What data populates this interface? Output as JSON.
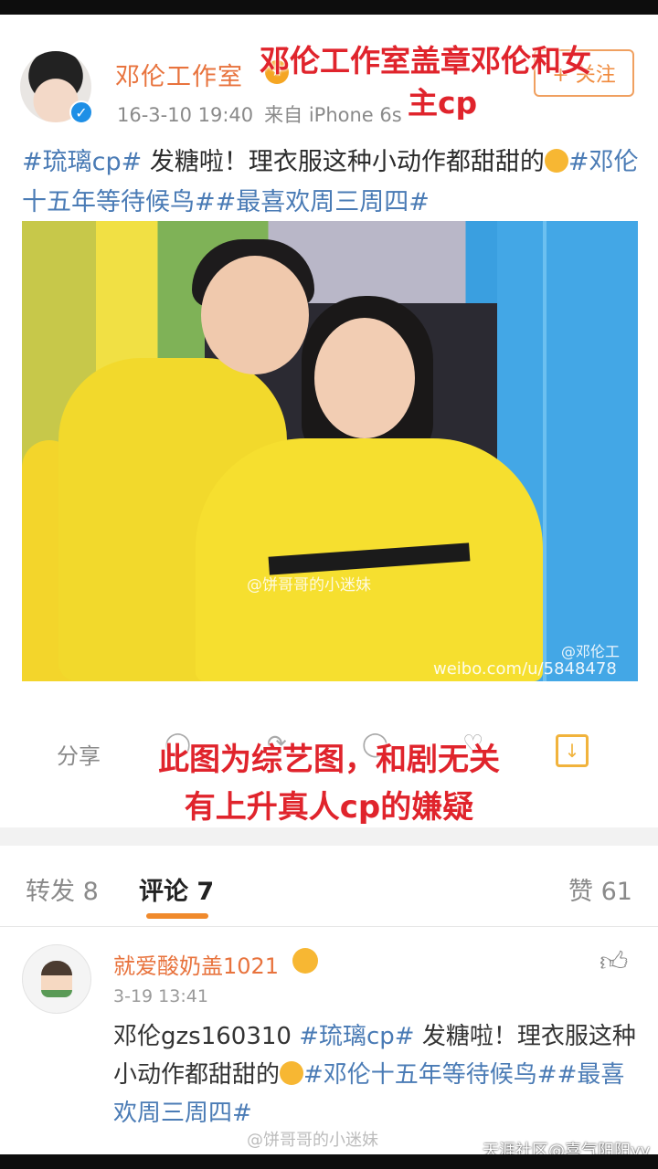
{
  "post": {
    "username": "邓伦工作室",
    "date": "16-3-10 19:40",
    "source": "来自 iPhone 6s",
    "follow_label": "+ 关注",
    "text_tag1": "#琉璃cp#",
    "text_body": " 发糖啦！理衣服这种小动作都甜甜的",
    "text_tag2": "#邓伦十五年等待候鸟##最喜欢周三周四#",
    "photo_watermark1": "@饼哥哥的小迷妹",
    "photo_watermark2": "@邓伦工",
    "photo_watermark3": "weibo.com/u/5848478"
  },
  "overlays": {
    "top_line1": "邓伦工作室盖章邓伦和女",
    "top_line2": "主cp",
    "mid_line1": "此图为综艺图，和剧无关",
    "mid_line2": "有上升真人cp的嫌疑"
  },
  "actions": {
    "share_label": "分享"
  },
  "tabs": {
    "repost": "转发 8",
    "comments": "评论 7",
    "likes": "赞 61"
  },
  "comment": {
    "name": "就爱酸奶盖1021",
    "time": "3-19 13:41",
    "text_prefix": "邓伦gzs160310 ",
    "text_tag1": "#琉璃cp#",
    "text_body": " 发糖啦！理衣服这种小动作都甜甜的",
    "text_tag2": "#邓伦十五年等待候鸟##最喜欢周三周四#"
  },
  "watermarks": {
    "weibo": "@饼哥哥的小迷妹",
    "site": "天涯社区@喜气阳阳yy"
  },
  "colors": {
    "username": "#e8733d",
    "tag": "#4a7bb5",
    "overlay_red": "#e0242c",
    "tab_accent": "#f08a2c"
  },
  "icons": [
    "verified-icon",
    "vip-badge-icon",
    "comment-icon",
    "repost-icon",
    "like-icon",
    "save-image-icon",
    "thumbs-up-icon"
  ]
}
